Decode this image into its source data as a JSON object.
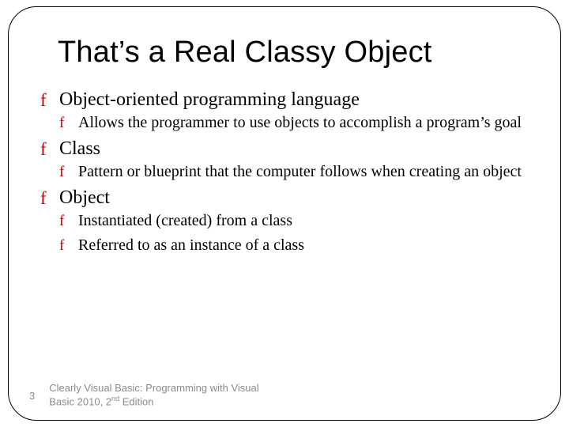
{
  "title": "That’s a Real Classy Object",
  "bullets": {
    "b1": "Object-oriented programming language",
    "b1a": "Allows the programmer to use objects to accomplish a program’s goal",
    "b2": "Class",
    "b2a": "Pattern or blueprint that the computer follows when creating an object",
    "b3": "Object",
    "b3a": "Instantiated (created) from a class",
    "b3b": "Referred to as an instance of a class"
  },
  "footer": {
    "page": "3",
    "text_pre": "Clearly Visual Basic: Programming with Visual Basic 2010, 2",
    "text_sup": "nd",
    "text_post": " Edition"
  },
  "bullet_glyph": "f"
}
